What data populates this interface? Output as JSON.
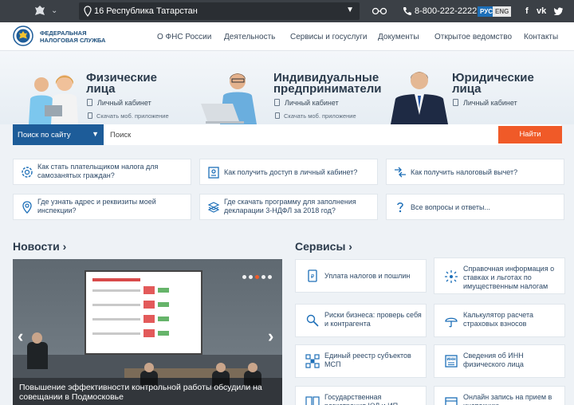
{
  "topbar": {
    "region": "16 Республика Татарстан",
    "phone": "8-800-222-2222",
    "lang_ru": "РУС",
    "lang_en": "ENG",
    "social": [
      "f",
      "vk",
      "tw"
    ]
  },
  "header": {
    "logo_line1": "ФЕДЕРАЛЬНАЯ",
    "logo_line2": "НАЛОГОВАЯ СЛУЖБА",
    "nav": [
      "О ФНС России",
      "Деятельность",
      "Сервисы и госуслуги",
      "Документы",
      "Открытое ведомство",
      "Контакты"
    ]
  },
  "categories": [
    {
      "title1": "Физические",
      "title2": "лица",
      "cabinet": "Личный кабинет",
      "app": "Скачать моб. приложение"
    },
    {
      "title1": "Индивидуальные",
      "title2": "предприниматели",
      "cabinet": "Личный кабинет",
      "app": "Скачать моб. приложение"
    },
    {
      "title1": "Юридические",
      "title2": "лица",
      "cabinet": "Личный кабинет"
    }
  ],
  "search": {
    "scope": "Поиск по сайту",
    "placeholder": "Поиск",
    "button": "Найти"
  },
  "faq": [
    "Как стать плательщиком налога для самозанятых граждан?",
    "Как получить доступ в личный кабинет?",
    "Как получить налоговый вычет?",
    "Где узнать адрес и реквизиты моей инспекции?",
    "Где скачать программу для заполнения декларации 3-НДФЛ за 2018 год?",
    "Все вопросы и ответы..."
  ],
  "news": {
    "heading": "Новости",
    "caption": "Повышение эффективности контрольной работы обсудили на совещании в Подмосковье",
    "slides": 5,
    "active_slide": 1
  },
  "services": {
    "heading": "Сервисы",
    "items": [
      "Уплата налогов и пошлин",
      "Справочная информация о ставках и льготах по имущественным налогам",
      "Риски бизнеса: проверь себя и контрагента",
      "Калькулятор расчета страховых взносов",
      "Единый реестр субъектов МСП",
      "Сведения об ИНН физического лица",
      "Государственная регистрация ЮЛ и ИП",
      "Онлайн запись на прием в инспекцию"
    ]
  },
  "colors": {
    "topbar": "#3b4046",
    "accent_blue": "#1d5c99",
    "accent_orange": "#f05a28",
    "icon_blue": "#1d6fb8"
  }
}
